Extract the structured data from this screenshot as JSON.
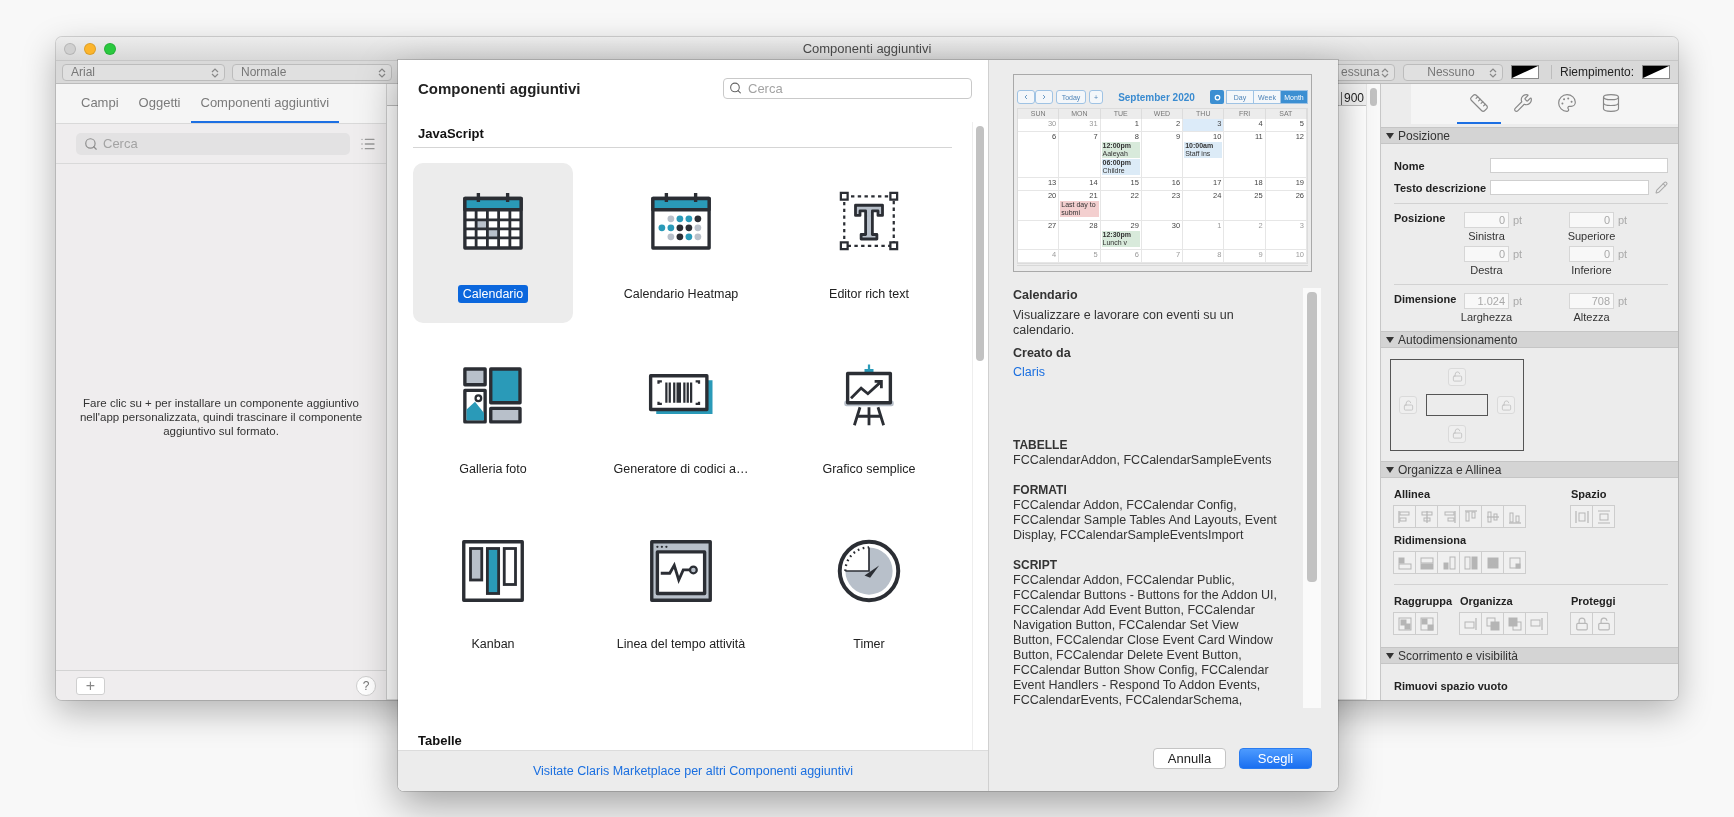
{
  "window": {
    "title": "Componenti aggiuntivi"
  },
  "toolbar": {
    "font": "Arial",
    "style": "Normale",
    "border_style": "essuna",
    "line_style": "Nessuno",
    "fill_label": "Riempimento:"
  },
  "left_panel": {
    "tabs": [
      {
        "label": "Campi",
        "selected": false
      },
      {
        "label": "Oggetti",
        "selected": false
      },
      {
        "label": "Componenti aggiuntivi",
        "selected": true
      }
    ],
    "search": {
      "placeholder": "Cerca"
    },
    "message": "Fare clic su + per installare un componente aggiuntivo nell'app personalizzata, quindi trascinare il componente aggiuntivo sul formato.",
    "add_button": "+",
    "help_button": "?"
  },
  "ruler": {
    "mark": "900"
  },
  "dialog": {
    "title": "Componenti aggiuntivi",
    "search": {
      "placeholder": "Cerca"
    },
    "sections": [
      {
        "title": "JavaScript",
        "items": [
          {
            "label": "Calendario",
            "kind": "calendar",
            "selected": true
          },
          {
            "label": "Calendario Heatmap",
            "kind": "heatmap",
            "selected": false
          },
          {
            "label": "Editor rich text",
            "kind": "text",
            "selected": false
          },
          {
            "label": "Galleria foto",
            "kind": "gallery",
            "selected": false
          },
          {
            "label": "Generatore di codici a…",
            "kind": "barcode",
            "selected": false
          },
          {
            "label": "Grafico semplice",
            "kind": "chart",
            "selected": false
          },
          {
            "label": "Kanban",
            "kind": "kanban",
            "selected": false
          },
          {
            "label": "Linea del tempo attività",
            "kind": "timeline",
            "selected": false
          },
          {
            "label": "Timer",
            "kind": "timer",
            "selected": false
          }
        ]
      },
      {
        "title": "Tabelle"
      }
    ],
    "footer_link": "Visitate Claris Marketplace per altri Componenti aggiuntivi",
    "preview": {
      "today": "Today",
      "add": "+",
      "month": "September 2020",
      "views": [
        {
          "label": "Day",
          "selected": false
        },
        {
          "label": "Week",
          "selected": false
        },
        {
          "label": "Month",
          "selected": true
        }
      ],
      "weekdays": [
        "SUN",
        "MON",
        "TUE",
        "WED",
        "THU",
        "FRI",
        "SAT"
      ],
      "weeks": [
        [
          {
            "day": "30",
            "muted": true,
            "today": false
          },
          {
            "day": "31",
            "muted": true,
            "today": false
          },
          {
            "day": "1",
            "muted": false,
            "today": false
          },
          {
            "day": "2",
            "muted": false,
            "today": false
          },
          {
            "day": "3",
            "muted": false,
            "today": true
          },
          {
            "day": "4",
            "muted": false,
            "today": false
          },
          {
            "day": "5",
            "muted": false,
            "today": false
          }
        ],
        [
          {
            "day": "6",
            "muted": false,
            "today": false
          },
          {
            "day": "7",
            "muted": false,
            "today": false
          },
          {
            "day": "8",
            "muted": false,
            "today": false,
            "events": [
              {
                "text": "**12:00pm** Aaleyah",
                "color": "#d8eadb"
              },
              {
                "text": "**06:00pm** Childre",
                "color": "#dcebf7"
              }
            ]
          },
          {
            "day": "9",
            "muted": false,
            "today": false
          },
          {
            "day": "10",
            "muted": false,
            "today": false,
            "events": [
              {
                "text": "**10:00am** Staff ins",
                "color": "#dcebf7"
              }
            ]
          },
          {
            "day": "11",
            "muted": false,
            "today": false
          },
          {
            "day": "12",
            "muted": false,
            "today": false
          }
        ],
        [
          {
            "day": "13",
            "muted": false,
            "today": false
          },
          {
            "day": "14",
            "muted": false,
            "today": false
          },
          {
            "day": "15",
            "muted": false,
            "today": false
          },
          {
            "day": "16",
            "muted": false,
            "today": false
          },
          {
            "day": "17",
            "muted": false,
            "today": false
          },
          {
            "day": "18",
            "muted": false,
            "today": false
          },
          {
            "day": "19",
            "muted": false,
            "today": false
          }
        ],
        [
          {
            "day": "20",
            "muted": false,
            "today": false
          },
          {
            "day": "21",
            "muted": false,
            "today": false,
            "events": [
              {
                "text": "Last day to submi",
                "color": "#f3cfcf"
              }
            ]
          },
          {
            "day": "22",
            "muted": false,
            "today": false
          },
          {
            "day": "23",
            "muted": false,
            "today": false
          },
          {
            "day": "24",
            "muted": false,
            "today": false
          },
          {
            "day": "25",
            "muted": false,
            "today": false
          },
          {
            "day": "26",
            "muted": false,
            "today": false
          }
        ],
        [
          {
            "day": "27",
            "muted": false,
            "today": false
          },
          {
            "day": "28",
            "muted": false,
            "today": false
          },
          {
            "day": "29",
            "muted": false,
            "today": false,
            "events": [
              {
                "text": "**12:30pm** Lunch v",
                "color": "#d8eadb"
              }
            ]
          },
          {
            "day": "30",
            "muted": false,
            "today": false
          },
          {
            "day": "1",
            "muted": true,
            "today": false
          },
          {
            "day": "2",
            "muted": true,
            "today": false
          },
          {
            "day": "3",
            "muted": true,
            "today": false
          }
        ],
        [
          {
            "day": "4",
            "muted": true,
            "today": false
          },
          {
            "day": "5",
            "muted": true,
            "today": false
          },
          {
            "day": "6",
            "muted": true,
            "today": false
          },
          {
            "day": "7",
            "muted": true,
            "today": false
          },
          {
            "day": "8",
            "muted": true,
            "today": false
          },
          {
            "day": "9",
            "muted": true,
            "today": false
          },
          {
            "day": "10",
            "muted": true,
            "today": false
          }
        ]
      ]
    },
    "details": {
      "name": "Calendario",
      "description": "Visualizzare e lavorare con eventi su un calendario.",
      "creator_heading": "Creato da",
      "creator": "Claris",
      "groups": [
        {
          "heading": "TABELLE",
          "text": "FCCalendarAddon, FCCalendarSampleEvents"
        },
        {
          "heading": "FORMATI",
          "text": "FCCalendar Addon, FCCalendar Config, FCCalendar Sample Tables And Layouts, Event Display, FCCalendarSampleEventsImport"
        },
        {
          "heading": "SCRIPT",
          "text": "FCCalendar Addon, FCCalendar Public, FCCalendar Buttons - Buttons for the Addon UI, FCCalendar Add Event Button, FCCalendar Navigation Button, FCCalendar Set View Button, FCCalendar Close Event Card Window Button, FCCalendar Delete Event Button, FCCalendar Button Show Config, FCCalendar Event Handlers - Respond To Addon Events, FCCalendarEvents, FCCalendarSchema,"
        }
      ]
    },
    "buttons": [
      {
        "label": "Annulla",
        "kind": "cancel"
      },
      {
        "label": "Scegli",
        "kind": "default"
      }
    ]
  },
  "inspector": {
    "tabs": [
      {
        "kind": "ruler",
        "selected": true
      },
      {
        "kind": "wrench",
        "selected": false
      },
      {
        "kind": "palette",
        "selected": false
      },
      {
        "kind": "database",
        "selected": false
      }
    ],
    "position": {
      "title": "Posizione",
      "expanded": true,
      "name_label": "Nome",
      "tooltip_label": "Testo descrizione",
      "position_label": "Posizione",
      "position_fields": [
        {
          "value": "0",
          "unit": "pt",
          "caption": "Sinistra"
        },
        {
          "value": "0",
          "unit": "pt",
          "caption": "Superiore"
        },
        {
          "value": "0",
          "unit": "pt",
          "caption": "Destra"
        },
        {
          "value": "0",
          "unit": "pt",
          "caption": "Inferiore"
        }
      ],
      "size_label": "Dimensione",
      "size_fields": [
        {
          "value": "1.024",
          "unit": "pt",
          "caption": "Larghezza"
        },
        {
          "value": "708",
          "unit": "pt",
          "caption": "Altezza"
        }
      ]
    },
    "autosize": {
      "title": "Autodimensionamento",
      "expanded": true
    },
    "arrange": {
      "title": "Organizza e Allinea",
      "expanded": true,
      "rows": [
        {
          "separated": false,
          "groups": [
            {
              "label": "Allinea"
            },
            {
              "label": "Spazio"
            }
          ]
        },
        {
          "separated": false,
          "groups": [
            {
              "label": "Ridimensiona"
            }
          ]
        },
        {
          "separated": true,
          "groups": [
            {
              "label": "Raggruppa"
            },
            {
              "label": "Organizza"
            },
            {
              "label": "Proteggi"
            }
          ]
        }
      ]
    },
    "scroll": {
      "title": "Scorrimento e visibilità",
      "expanded": true,
      "label": "Rimuovi spazio vuoto"
    }
  }
}
